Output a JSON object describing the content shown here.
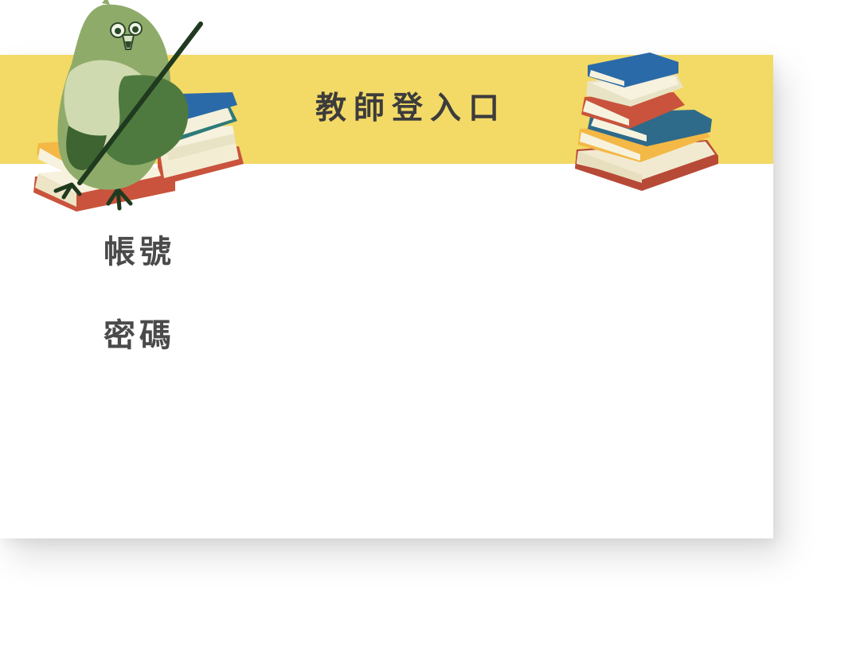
{
  "header": {
    "title": "教師登入口"
  },
  "form": {
    "account": {
      "label": "帳號",
      "value": "",
      "placeholder": ""
    },
    "password": {
      "label": "密碼",
      "value": "",
      "placeholder": ""
    }
  },
  "colors": {
    "header_band": "#f3d966",
    "text": "#4a4a4a",
    "card": "#ffffff"
  },
  "illustrations": {
    "left": "owl-teacher-with-pointer-on-book-stack",
    "right": "book-stack"
  }
}
